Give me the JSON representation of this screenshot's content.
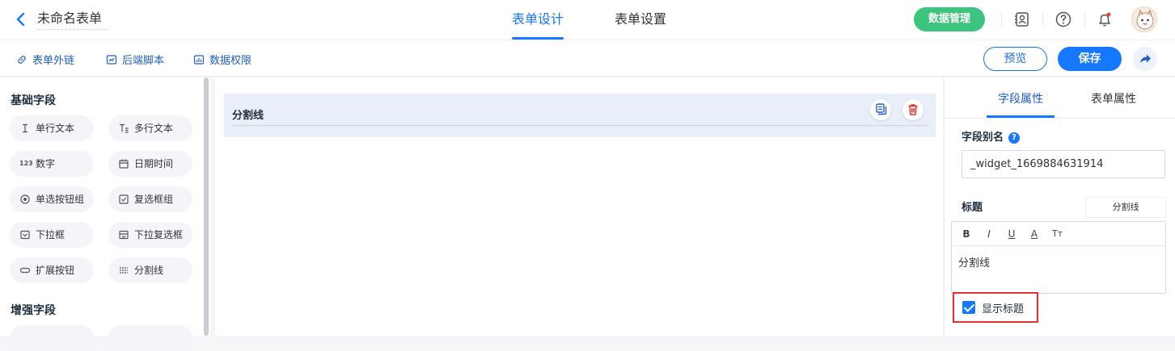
{
  "header": {
    "form_name": "未命名表单",
    "tabs": [
      "表单设计",
      "表单设置"
    ],
    "active_tab": 0,
    "data_manage_label": "数据管理",
    "accent_color": "#1677ff",
    "data_btn_color": "#3dc47e"
  },
  "subbar": {
    "links": [
      "表单外链",
      "后端脚本",
      "数据权限"
    ],
    "preview_label": "预览",
    "save_label": "保存"
  },
  "left": {
    "basic_title": "基础字段",
    "basic_fields": [
      {
        "label": "单行文本",
        "icon": "text-cursor-icon"
      },
      {
        "label": "多行文本",
        "icon": "multiline-text-icon"
      },
      {
        "label": "数字",
        "icon": "number-icon",
        "glyph": "123"
      },
      {
        "label": "日期时间",
        "icon": "calendar-icon"
      },
      {
        "label": "单选按钮组",
        "icon": "radio-icon"
      },
      {
        "label": "复选框组",
        "icon": "checkbox-icon"
      },
      {
        "label": "下拉框",
        "icon": "dropdown-icon"
      },
      {
        "label": "下拉复选框",
        "icon": "dropdown-multi-icon"
      },
      {
        "label": "扩展按钮",
        "icon": "button-icon"
      },
      {
        "label": "分割线",
        "icon": "divider-icon"
      }
    ],
    "enhanced_title": "增强字段"
  },
  "canvas": {
    "divider_label": "分割线"
  },
  "right": {
    "tabs": [
      "字段属性",
      "表单属性"
    ],
    "active_tab": 0,
    "alias_label": "字段别名",
    "alias_value": "_widget_1669884631914",
    "title_label": "标题",
    "title_tag": "分割线",
    "rte_tools": [
      "B",
      "I",
      "U",
      "A",
      "Tт"
    ],
    "rte_content": "分割线",
    "show_title_label": "显示标题",
    "show_title_checked": true
  }
}
